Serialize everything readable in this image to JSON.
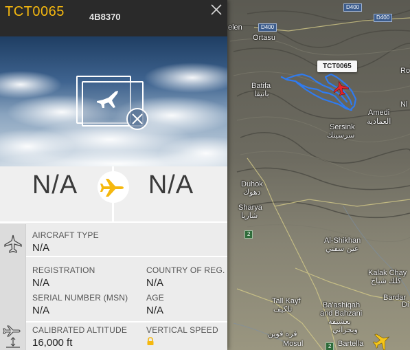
{
  "flight": {
    "callsign": "TCT0065",
    "icao_hex": "4B8370",
    "map_tag": "TCT0065"
  },
  "route": {
    "origin": "N/A",
    "destination": "N/A"
  },
  "aircraft": {
    "type_label": "AIRCRAFT TYPE",
    "type_value": "N/A",
    "registration_label": "REGISTRATION",
    "registration_value": "N/A",
    "country_label": "COUNTRY OF REG.",
    "country_value": "N/A",
    "serial_label": "SERIAL NUMBER (MSN)",
    "serial_value": "N/A",
    "age_label": "AGE",
    "age_value": "N/A"
  },
  "altitude": {
    "calibrated_label": "CALIBRATED ALTITUDE",
    "calibrated_value": "16,000 ft",
    "vertical_label": "VERTICAL SPEED"
  },
  "map": {
    "labels": [
      {
        "key": "elen",
        "text": "elen"
      },
      {
        "key": "ortasu",
        "text": "Ortasu"
      },
      {
        "key": "batifa",
        "text": "Batifa"
      },
      {
        "key": "batifa_ar",
        "text": "باتيفا"
      },
      {
        "key": "amedi",
        "text": "Amedi"
      },
      {
        "key": "amedi_ar",
        "text": "العمادية"
      },
      {
        "key": "sersink",
        "text": "Sersink"
      },
      {
        "key": "sersink_ar",
        "text": "سرسينك"
      },
      {
        "key": "duhok",
        "text": "Duhok"
      },
      {
        "key": "duhok_ar",
        "text": "دهوك"
      },
      {
        "key": "sharya",
        "text": "Sharya"
      },
      {
        "key": "sharya_ar",
        "text": "شاريا"
      },
      {
        "key": "alshikhan",
        "text": "Al-Shikhan"
      },
      {
        "key": "alshikhan_ar",
        "text": "عين سفني"
      },
      {
        "key": "kalakchay",
        "text": "Kalak Chay"
      },
      {
        "key": "kalakchay_ar",
        "text": "كلك شياخ"
      },
      {
        "key": "tallkayf",
        "text": "Tall Kayf"
      },
      {
        "key": "tallkayf_ar",
        "text": "تلكيف"
      },
      {
        "key": "bashiqah",
        "text": "Ba'ashiqah"
      },
      {
        "key": "bahzani",
        "text": "and Bahzani"
      },
      {
        "key": "bashiqah_ar",
        "text": "بعشيقة"
      },
      {
        "key": "bahzani_ar",
        "text": "وبحزاني"
      },
      {
        "key": "bardar",
        "text": "Bardar"
      },
      {
        "key": "qarah_ar",
        "text": "قره قوين"
      },
      {
        "key": "mosul",
        "text": "Mosul"
      },
      {
        "key": "bartella",
        "text": "Bartella"
      },
      {
        "key": "roste",
        "text": "Ro"
      },
      {
        "key": "nl",
        "text": "Nl"
      },
      {
        "key": "di",
        "text": "Di"
      }
    ],
    "roads": {
      "d400_a": "D400",
      "d400_b": "D400",
      "d400_c": "D400",
      "r2_a": "2",
      "r2_b": "2"
    },
    "colors": {
      "track": "#2f7bf0",
      "selected_plane": "#e8242a",
      "other_plane": "#f5c518",
      "callsign": "#f5b80f"
    }
  },
  "icons": [
    "close-icon",
    "photo-unavailable-icon",
    "plane-icon",
    "aircraft-icon",
    "altitude-icon",
    "lock-icon"
  ]
}
